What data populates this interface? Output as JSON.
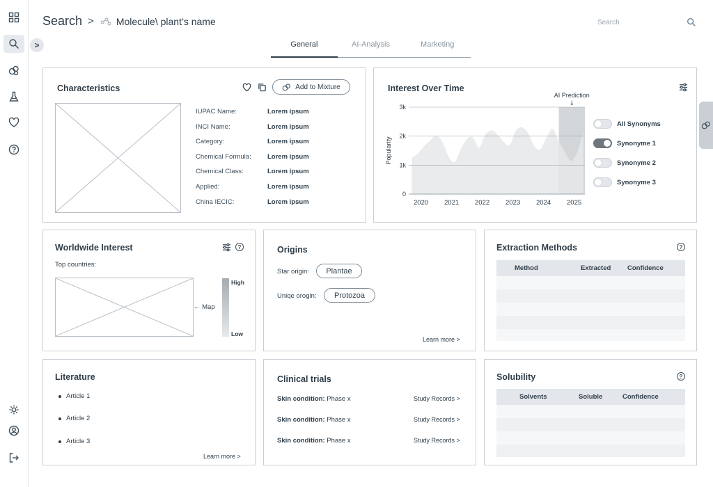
{
  "breadcrumb": {
    "root": "Search",
    "separator": ">",
    "leaf": "Molecule\\ plant’s name"
  },
  "search": {
    "placeholder": "Search"
  },
  "tabs": [
    {
      "label": "General",
      "active": true
    },
    {
      "label": "AI-Analysis",
      "active": false
    },
    {
      "label": "Marketing",
      "active": false
    }
  ],
  "sidebar": {
    "items": [
      {
        "name": "dashboard",
        "icon": "grid-icon"
      },
      {
        "name": "search",
        "icon": "search-icon",
        "active": true
      },
      {
        "name": "mixture",
        "icon": "bubbles-icon"
      },
      {
        "name": "lab",
        "icon": "flask-icon"
      },
      {
        "name": "favorites",
        "icon": "heart-icon"
      },
      {
        "name": "help",
        "icon": "help-icon"
      }
    ],
    "bottom": [
      {
        "name": "theme",
        "icon": "sun-icon"
      },
      {
        "name": "profile",
        "icon": "user-icon"
      },
      {
        "name": "logout",
        "icon": "logout-icon"
      }
    ]
  },
  "characteristics": {
    "title": "Characteristics",
    "add_button": "Add to Mixture",
    "fields": [
      {
        "label": "IUPAC Name:",
        "value": "Lorem ipsum"
      },
      {
        "label": "INCI Name:",
        "value": "Lorem ipsum"
      },
      {
        "label": "Category:",
        "value": "Lorem ipsum"
      },
      {
        "label": "Chemical Formula:",
        "value": "Lorem ipsum"
      },
      {
        "label": "Chemical Class:",
        "value": "Lorem ipsum"
      },
      {
        "label": "Applied:",
        "value": "Lorem ipsum"
      },
      {
        "label": "China IECIC:",
        "value": "Lorem ipsum"
      }
    ]
  },
  "interest": {
    "title": "Interest Over Time",
    "prediction_label": "AI Prediction",
    "prediction_arrow": "↓",
    "toggles": [
      {
        "label": "All Synonyms",
        "on": false
      },
      {
        "label": "Synonyme 1",
        "on": true
      },
      {
        "label": "Synonyme 2",
        "on": false
      },
      {
        "label": "Synonyme 3",
        "on": false
      }
    ]
  },
  "chart_data": {
    "type": "area",
    "title": "Interest Over Time",
    "xlabel": "",
    "ylabel": "Popularity",
    "x": [
      2019.7,
      2019.9,
      2020.1,
      2020.3,
      2020.5,
      2020.7,
      2020.9,
      2021.1,
      2021.3,
      2021.5,
      2021.7,
      2021.9,
      2022.1,
      2022.3,
      2022.5,
      2022.7,
      2022.9,
      2023.1,
      2023.3,
      2023.5,
      2023.7,
      2023.9,
      2024.1,
      2024.3,
      2024.5,
      2024.7,
      2024.9,
      2025.1,
      2025.3
    ],
    "y": [
      1250,
      1400,
      1650,
      1850,
      2000,
      1800,
      1300,
      1100,
      1550,
      1900,
      1950,
      1600,
      2050,
      2200,
      2050,
      1800,
      1700,
      2200,
      2300,
      2100,
      1650,
      1550,
      1950,
      2250,
      1800,
      1450,
      1150,
      1450,
      2150
    ],
    "xticks": [
      "2020",
      "2021",
      "2022",
      "2023",
      "2024",
      "2025"
    ],
    "yticks": [
      "0",
      "1k",
      "2k",
      "3k"
    ],
    "ylim": [
      0,
      3000
    ],
    "xlim": [
      2019.6,
      2025.35
    ],
    "prediction_start": 2024.5,
    "colors": {
      "area": "#e5e7e9",
      "prediction": "#d3d6d9",
      "line": "#9aa4ad"
    }
  },
  "worldwide": {
    "title": "Worldwide Interest",
    "subtitle": "Top countries:",
    "map_label": "← Map",
    "legend_high": "High",
    "legend_low": "Low"
  },
  "origins": {
    "title": "Origins",
    "star_label": "Star origin:",
    "star_value": "Plantae",
    "unique_label": "Uniqe orogin:",
    "unique_value": "Protozoa",
    "learn_more": "Learn more >"
  },
  "extraction": {
    "title": "Extraction Methods",
    "columns": [
      "Method",
      "Extracted",
      "Confidence"
    ]
  },
  "literature": {
    "title": "Literature",
    "articles": [
      "Article 1",
      "Article 2",
      "Article 3"
    ],
    "learn_more": "Learn more >"
  },
  "clinical": {
    "title": "Clinical trials",
    "rows": [
      {
        "label": "Skin condition:",
        "phase": "Phase x",
        "link": "Study Records >"
      },
      {
        "label": "Skin condition:",
        "phase": "Phase x",
        "link": "Study Records >"
      },
      {
        "label": "Skin condition:",
        "phase": "Phase x",
        "link": "Study Records >"
      }
    ]
  },
  "solubility": {
    "title": "Solubility",
    "columns": [
      "Solvents",
      "Soluble",
      "Confidence"
    ]
  },
  "colors": {
    "text": "#2f3e4a",
    "border": "#c9cfd5",
    "muted": "#8a96a1",
    "accent": "#6b8396"
  }
}
